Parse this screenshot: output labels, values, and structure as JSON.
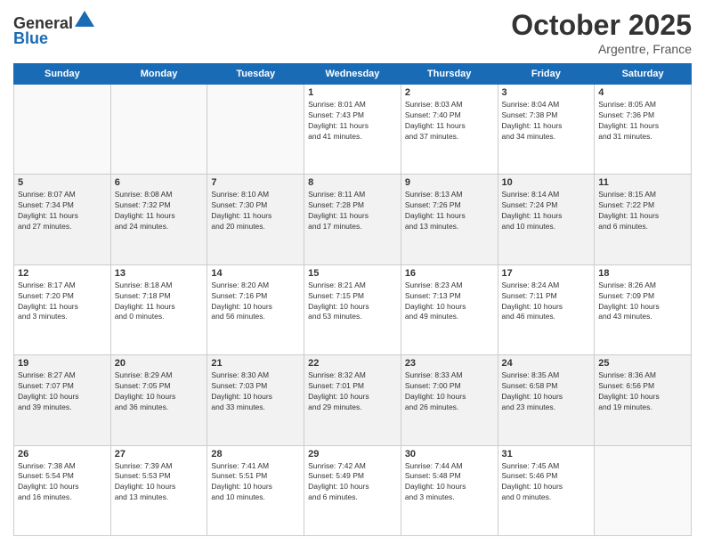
{
  "header": {
    "logo_line1": "General",
    "logo_line2": "Blue",
    "month": "October 2025",
    "location": "Argentre, France"
  },
  "weekdays": [
    "Sunday",
    "Monday",
    "Tuesday",
    "Wednesday",
    "Thursday",
    "Friday",
    "Saturday"
  ],
  "weeks": [
    [
      {
        "day": "",
        "info": ""
      },
      {
        "day": "",
        "info": ""
      },
      {
        "day": "",
        "info": ""
      },
      {
        "day": "1",
        "info": "Sunrise: 8:01 AM\nSunset: 7:43 PM\nDaylight: 11 hours\nand 41 minutes."
      },
      {
        "day": "2",
        "info": "Sunrise: 8:03 AM\nSunset: 7:40 PM\nDaylight: 11 hours\nand 37 minutes."
      },
      {
        "day": "3",
        "info": "Sunrise: 8:04 AM\nSunset: 7:38 PM\nDaylight: 11 hours\nand 34 minutes."
      },
      {
        "day": "4",
        "info": "Sunrise: 8:05 AM\nSunset: 7:36 PM\nDaylight: 11 hours\nand 31 minutes."
      }
    ],
    [
      {
        "day": "5",
        "info": "Sunrise: 8:07 AM\nSunset: 7:34 PM\nDaylight: 11 hours\nand 27 minutes."
      },
      {
        "day": "6",
        "info": "Sunrise: 8:08 AM\nSunset: 7:32 PM\nDaylight: 11 hours\nand 24 minutes."
      },
      {
        "day": "7",
        "info": "Sunrise: 8:10 AM\nSunset: 7:30 PM\nDaylight: 11 hours\nand 20 minutes."
      },
      {
        "day": "8",
        "info": "Sunrise: 8:11 AM\nSunset: 7:28 PM\nDaylight: 11 hours\nand 17 minutes."
      },
      {
        "day": "9",
        "info": "Sunrise: 8:13 AM\nSunset: 7:26 PM\nDaylight: 11 hours\nand 13 minutes."
      },
      {
        "day": "10",
        "info": "Sunrise: 8:14 AM\nSunset: 7:24 PM\nDaylight: 11 hours\nand 10 minutes."
      },
      {
        "day": "11",
        "info": "Sunrise: 8:15 AM\nSunset: 7:22 PM\nDaylight: 11 hours\nand 6 minutes."
      }
    ],
    [
      {
        "day": "12",
        "info": "Sunrise: 8:17 AM\nSunset: 7:20 PM\nDaylight: 11 hours\nand 3 minutes."
      },
      {
        "day": "13",
        "info": "Sunrise: 8:18 AM\nSunset: 7:18 PM\nDaylight: 11 hours\nand 0 minutes."
      },
      {
        "day": "14",
        "info": "Sunrise: 8:20 AM\nSunset: 7:16 PM\nDaylight: 10 hours\nand 56 minutes."
      },
      {
        "day": "15",
        "info": "Sunrise: 8:21 AM\nSunset: 7:15 PM\nDaylight: 10 hours\nand 53 minutes."
      },
      {
        "day": "16",
        "info": "Sunrise: 8:23 AM\nSunset: 7:13 PM\nDaylight: 10 hours\nand 49 minutes."
      },
      {
        "day": "17",
        "info": "Sunrise: 8:24 AM\nSunset: 7:11 PM\nDaylight: 10 hours\nand 46 minutes."
      },
      {
        "day": "18",
        "info": "Sunrise: 8:26 AM\nSunset: 7:09 PM\nDaylight: 10 hours\nand 43 minutes."
      }
    ],
    [
      {
        "day": "19",
        "info": "Sunrise: 8:27 AM\nSunset: 7:07 PM\nDaylight: 10 hours\nand 39 minutes."
      },
      {
        "day": "20",
        "info": "Sunrise: 8:29 AM\nSunset: 7:05 PM\nDaylight: 10 hours\nand 36 minutes."
      },
      {
        "day": "21",
        "info": "Sunrise: 8:30 AM\nSunset: 7:03 PM\nDaylight: 10 hours\nand 33 minutes."
      },
      {
        "day": "22",
        "info": "Sunrise: 8:32 AM\nSunset: 7:01 PM\nDaylight: 10 hours\nand 29 minutes."
      },
      {
        "day": "23",
        "info": "Sunrise: 8:33 AM\nSunset: 7:00 PM\nDaylight: 10 hours\nand 26 minutes."
      },
      {
        "day": "24",
        "info": "Sunrise: 8:35 AM\nSunset: 6:58 PM\nDaylight: 10 hours\nand 23 minutes."
      },
      {
        "day": "25",
        "info": "Sunrise: 8:36 AM\nSunset: 6:56 PM\nDaylight: 10 hours\nand 19 minutes."
      }
    ],
    [
      {
        "day": "26",
        "info": "Sunrise: 7:38 AM\nSunset: 5:54 PM\nDaylight: 10 hours\nand 16 minutes."
      },
      {
        "day": "27",
        "info": "Sunrise: 7:39 AM\nSunset: 5:53 PM\nDaylight: 10 hours\nand 13 minutes."
      },
      {
        "day": "28",
        "info": "Sunrise: 7:41 AM\nSunset: 5:51 PM\nDaylight: 10 hours\nand 10 minutes."
      },
      {
        "day": "29",
        "info": "Sunrise: 7:42 AM\nSunset: 5:49 PM\nDaylight: 10 hours\nand 6 minutes."
      },
      {
        "day": "30",
        "info": "Sunrise: 7:44 AM\nSunset: 5:48 PM\nDaylight: 10 hours\nand 3 minutes."
      },
      {
        "day": "31",
        "info": "Sunrise: 7:45 AM\nSunset: 5:46 PM\nDaylight: 10 hours\nand 0 minutes."
      },
      {
        "day": "",
        "info": ""
      }
    ]
  ]
}
